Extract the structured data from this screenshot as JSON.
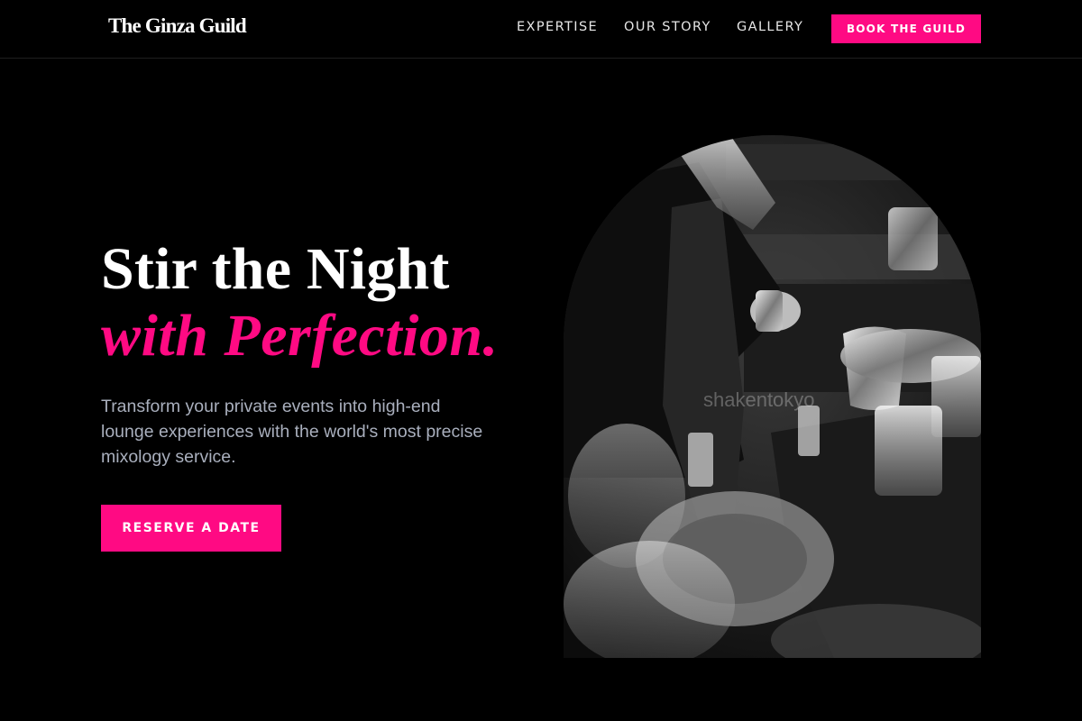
{
  "header": {
    "logo": "The Ginza Guild",
    "nav": [
      {
        "label": "EXPERTISE"
      },
      {
        "label": "OUR STORY"
      },
      {
        "label": "GALLERY"
      }
    ],
    "cta_label": "BOOK THE GUILD"
  },
  "hero": {
    "headline_line1": "Stir the Night",
    "headline_line2": "with Perfection.",
    "subtext": "Transform your private events into high-end lounge experiences with the world's most precise mixology service.",
    "cta_label": "RESERVE A DATE",
    "image": {
      "description_icon": "bartender-photo",
      "watermark": "shakentokyo"
    }
  },
  "colors": {
    "background": "#000000",
    "accent": "#ff0a83",
    "text_primary": "#ffffff",
    "text_muted": "#a9afbd"
  }
}
